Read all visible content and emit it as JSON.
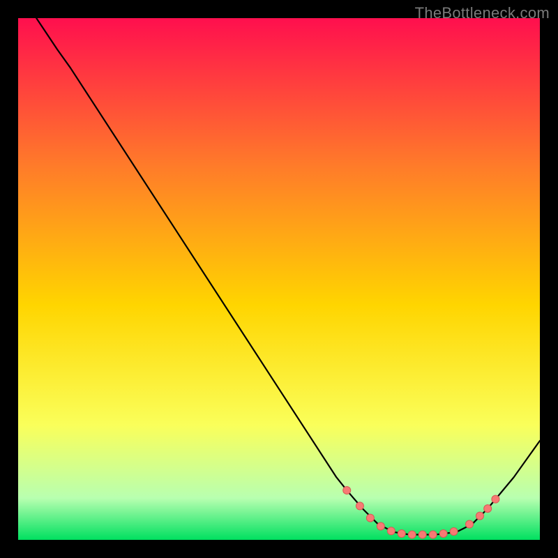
{
  "watermark": "TheBottleneck.com",
  "colors": {
    "background": "#000000",
    "gradient_top": "#ff0f4e",
    "gradient_upper_mid": "#ff7a2a",
    "gradient_mid": "#ffd500",
    "gradient_lower_mid": "#faff5a",
    "gradient_low_green_pale": "#b8ffb0",
    "gradient_bottom": "#00e060",
    "curve": "#000000",
    "dot_fill": "#f77a74",
    "dot_stroke": "#d85a54"
  },
  "chart_data": {
    "type": "line",
    "title": "",
    "xlabel": "",
    "ylabel": "",
    "x_range": [
      0,
      100
    ],
    "y_range": [
      0,
      100
    ],
    "series": [
      {
        "name": "curve",
        "points": [
          {
            "x": 3.5,
            "y": 100
          },
          {
            "x": 7.5,
            "y": 94
          },
          {
            "x": 10,
            "y": 90.5
          },
          {
            "x": 61,
            "y": 12
          },
          {
            "x": 63,
            "y": 9.5
          },
          {
            "x": 66,
            "y": 6
          },
          {
            "x": 69,
            "y": 3
          },
          {
            "x": 72,
            "y": 1.5
          },
          {
            "x": 75,
            "y": 1
          },
          {
            "x": 80,
            "y": 1
          },
          {
            "x": 84,
            "y": 1.5
          },
          {
            "x": 87,
            "y": 3
          },
          {
            "x": 90,
            "y": 6
          },
          {
            "x": 95,
            "y": 12
          },
          {
            "x": 100,
            "y": 19
          }
        ]
      }
    ],
    "markers": [
      {
        "x": 63,
        "y": 9.5
      },
      {
        "x": 65.5,
        "y": 6.5
      },
      {
        "x": 67.5,
        "y": 4.2
      },
      {
        "x": 69.5,
        "y": 2.6
      },
      {
        "x": 71.5,
        "y": 1.7
      },
      {
        "x": 73.5,
        "y": 1.2
      },
      {
        "x": 75.5,
        "y": 1.0
      },
      {
        "x": 77.5,
        "y": 1.0
      },
      {
        "x": 79.5,
        "y": 1.0
      },
      {
        "x": 81.5,
        "y": 1.2
      },
      {
        "x": 83.5,
        "y": 1.6
      },
      {
        "x": 86.5,
        "y": 3.0
      },
      {
        "x": 88.5,
        "y": 4.6
      },
      {
        "x": 90,
        "y": 6.0
      },
      {
        "x": 91.5,
        "y": 7.8
      }
    ]
  }
}
